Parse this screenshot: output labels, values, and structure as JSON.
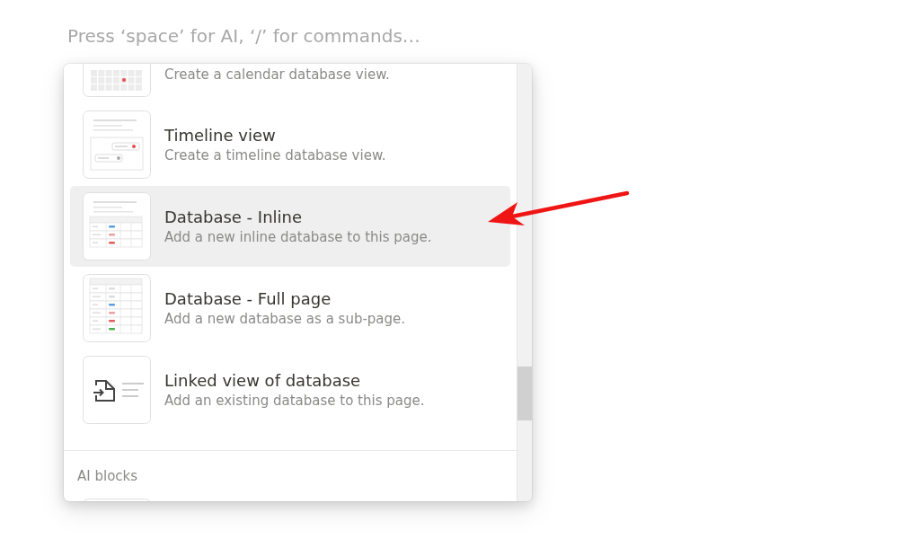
{
  "editor": {
    "placeholder": "Press ‘space’ for AI, ‘/’ for commands…"
  },
  "menu": {
    "items": [
      {
        "kind": "calendar",
        "description": "Create a calendar database view.",
        "selected": false
      },
      {
        "kind": "timeline",
        "title": "Timeline view",
        "description": "Create a timeline database view.",
        "selected": false
      },
      {
        "kind": "table-inline",
        "title": "Database - Inline",
        "description": "Add a new inline database to this page.",
        "selected": true
      },
      {
        "kind": "table-full",
        "title": "Database - Full page",
        "description": "Add a new database as a sub-page.",
        "selected": false
      },
      {
        "kind": "linked",
        "title": "Linked view of database",
        "description": "Add an existing database to this page.",
        "selected": false
      }
    ],
    "section": "AI blocks"
  }
}
